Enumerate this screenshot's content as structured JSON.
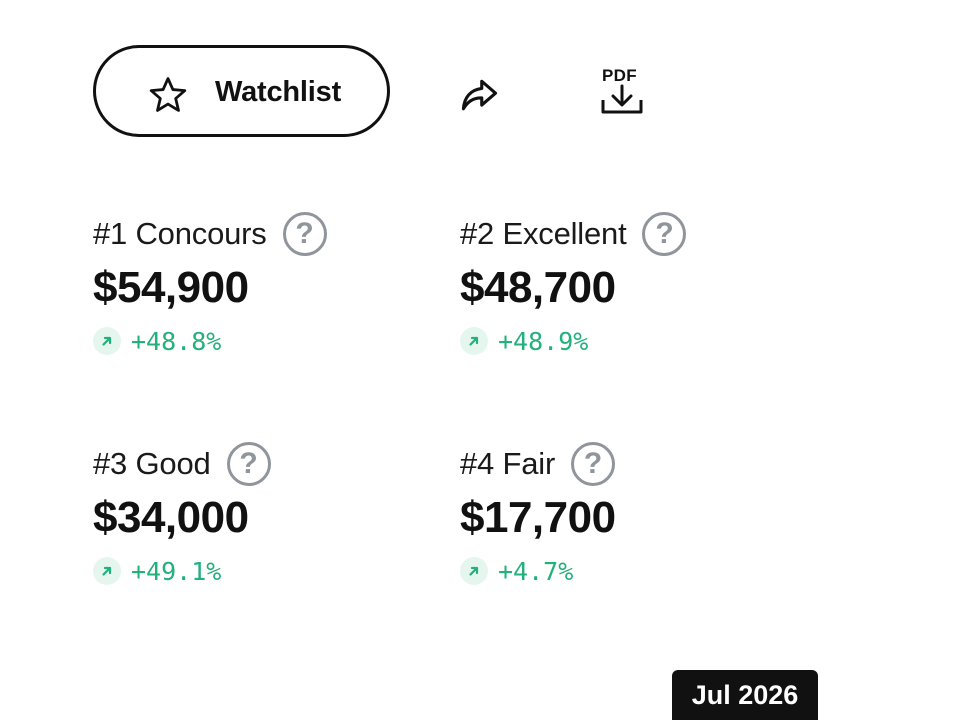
{
  "toolbar": {
    "watchlist_label": "Watchlist",
    "star_icon": "star-outline",
    "share_icon": "share-arrow",
    "pdf_label": "PDF",
    "download_icon": "download-tray"
  },
  "valuations": [
    {
      "grade": "#1 Concours",
      "price": "$54,900",
      "change": "+48.8%"
    },
    {
      "grade": "#2 Excellent",
      "price": "$48,700",
      "change": "+48.9%"
    },
    {
      "grade": "#3 Good",
      "price": "$34,000",
      "change": "+49.1%"
    },
    {
      "grade": "#4 Fair",
      "price": "$17,700",
      "change": "+4.7%"
    }
  ],
  "help_glyph": "?",
  "date_tooltip": "Jul 2026",
  "colors": {
    "positive": "#22b07d",
    "positive_bg": "#e5f6ef",
    "help_icon": "#8f959b",
    "tooltip_bg": "#111111"
  }
}
